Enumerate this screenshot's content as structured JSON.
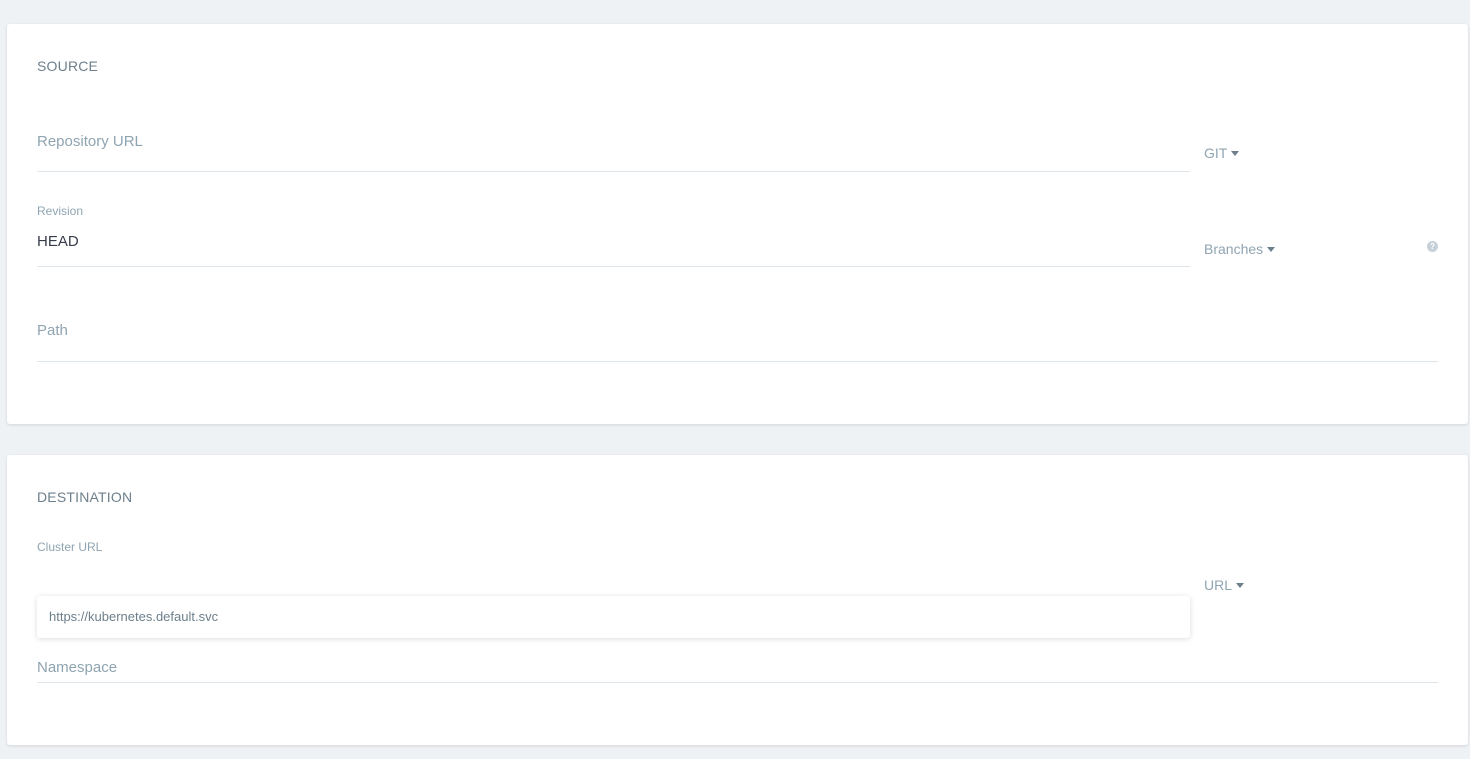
{
  "source": {
    "title": "SOURCE",
    "repo_url": {
      "placeholder": "Repository URL",
      "value": ""
    },
    "repo_type_dropdown": "GIT",
    "revision": {
      "label": "Revision",
      "value": "HEAD"
    },
    "revision_type_dropdown": "Branches",
    "help_icon_glyph": "?",
    "path": {
      "placeholder": "Path",
      "value": ""
    }
  },
  "destination": {
    "title": "DESTINATION",
    "cluster_url": {
      "label": "Cluster URL",
      "value": ""
    },
    "cluster_type_dropdown": "URL",
    "autocomplete_options": [
      "https://kubernetes.default.svc"
    ],
    "namespace": {
      "placeholder": "Namespace",
      "value": ""
    }
  },
  "icons": {
    "caret": "caret-down-icon",
    "help": "question-circle-icon"
  }
}
